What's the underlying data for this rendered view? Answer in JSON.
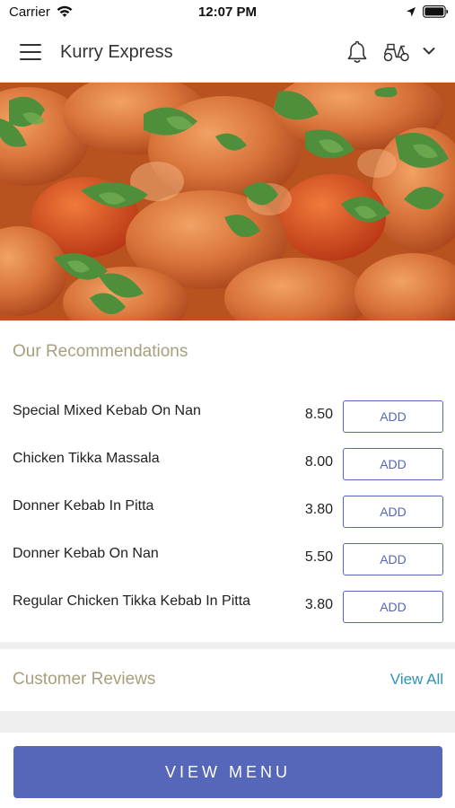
{
  "status_bar": {
    "carrier": "Carrier",
    "time": "12:07 PM"
  },
  "header": {
    "title": "Kurry Express",
    "icons": [
      "menu-icon",
      "bell-icon",
      "scooter-icon",
      "chevron-down-icon"
    ]
  },
  "hero": {
    "icon": "curry-dish-photo"
  },
  "recommendations": {
    "title": "Our Recommendations",
    "items": [
      {
        "name": "Special Mixed Kebab On Nan",
        "price": "8.50",
        "action": "ADD"
      },
      {
        "name": "Chicken Tikka Massala",
        "price": "8.00",
        "action": "ADD"
      },
      {
        "name": "Donner Kebab In Pitta",
        "price": "3.80",
        "action": "ADD"
      },
      {
        "name": "Donner Kebab On Nan",
        "price": "5.50",
        "action": "ADD"
      },
      {
        "name": "Regular Chicken Tikka Kebab In Pitta",
        "price": "3.80",
        "action": "ADD"
      }
    ]
  },
  "reviews": {
    "title": "Customer Reviews",
    "view_all": "View All"
  },
  "footer": {
    "view_menu": "VIEW MENU"
  },
  "colors": {
    "accent": "#5666b8",
    "section_title": "#a89f7c",
    "link": "#2a95b5"
  }
}
